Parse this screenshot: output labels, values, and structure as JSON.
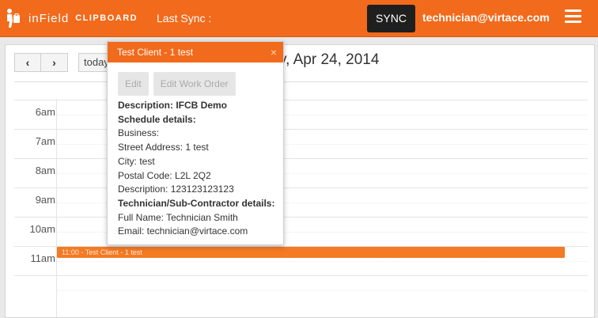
{
  "header": {
    "brand_in": "inField",
    "brand_clip": "CLIPBOARD",
    "last_sync": "Last Sync :",
    "sync_label": "SYNC",
    "user_email": "technician@virtace.com",
    "accent_color": "#f26a1b",
    "icons": [
      "logo-figure-icon",
      "hamburger-menu-icon"
    ]
  },
  "calendar": {
    "prev_label": "‹",
    "next_label": "›",
    "today_label": "today",
    "title": "y, Apr 24, 2014",
    "hours": [
      "6am",
      "7am",
      "8am",
      "9am",
      "10am",
      "11am"
    ],
    "event": {
      "label": "11:00 - Test Client - 1 test",
      "color": "#f47a24"
    }
  },
  "popover": {
    "title": "Test Client - 1 test",
    "close_label": "×",
    "edit_label": "Edit",
    "edit_work_order_label": "Edit Work Order",
    "description_line": "Description: IFCB Demo",
    "schedule_heading": "Schedule details:",
    "business_line": "Business:",
    "street_line": "Street Address: 1 test",
    "city_line": "City: test",
    "postal_line": "Postal Code: L2L 2Q2",
    "desc2_line": "Description: 123123123123",
    "tech_heading": "Technician/Sub-Contractor details:",
    "fullname_line": "Full Name: Technician Smith",
    "email_line": "Email: technician@virtace.com"
  }
}
